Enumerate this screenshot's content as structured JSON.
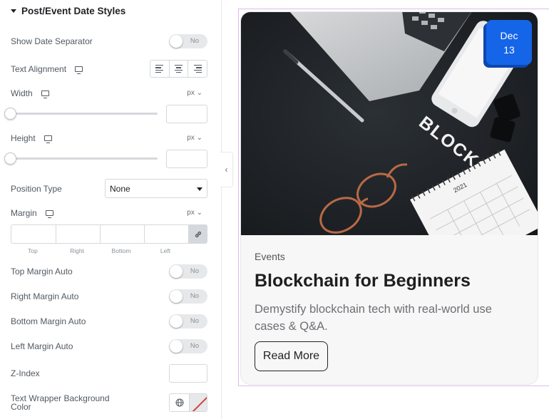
{
  "panel": {
    "section_title": "Post/Event Date Styles",
    "show_separator": {
      "label": "Show Date Separator",
      "value": "No"
    },
    "text_alignment": {
      "label": "Text Alignment",
      "options": [
        "align-left-icon",
        "align-center-icon",
        "align-right-icon"
      ]
    },
    "width": {
      "label": "Width",
      "unit": "px",
      "value": ""
    },
    "height": {
      "label": "Height",
      "unit": "px",
      "value": ""
    },
    "position_type": {
      "label": "Position Type",
      "selected": "None"
    },
    "margin": {
      "label": "Margin",
      "unit": "px",
      "fields": [
        "Top",
        "Right",
        "Bottom",
        "Left"
      ]
    },
    "top_margin_auto": {
      "label": "Top Margin Auto",
      "value": "No"
    },
    "right_margin_auto": {
      "label": "Right Margin Auto",
      "value": "No"
    },
    "bottom_margin_auto": {
      "label": "Bottom Margin Auto",
      "value": "No"
    },
    "left_margin_auto": {
      "label": "Left Margin Auto",
      "value": "No"
    },
    "z_index": {
      "label": "Z-Index",
      "value": ""
    },
    "text_wrapper_bg": {
      "label_line1": "Text Wrapper Background",
      "label_line2": "Color"
    },
    "collapse_glyph": "‹"
  },
  "card": {
    "date_month": "Dec",
    "date_day": "13",
    "photo_text": "BLOCKCHAIN",
    "calendar_year": "2021",
    "category": "Events",
    "title": "Blockchain for Beginners",
    "description": "Demystify blockchain tech with real-world use cases & Q&A.",
    "button": "Read More"
  },
  "colors": {
    "accent": "#1565e8",
    "panel_text": "#515962",
    "toggle_bg": "#e6e8ea",
    "preview_outline": "#e2b8ee"
  }
}
